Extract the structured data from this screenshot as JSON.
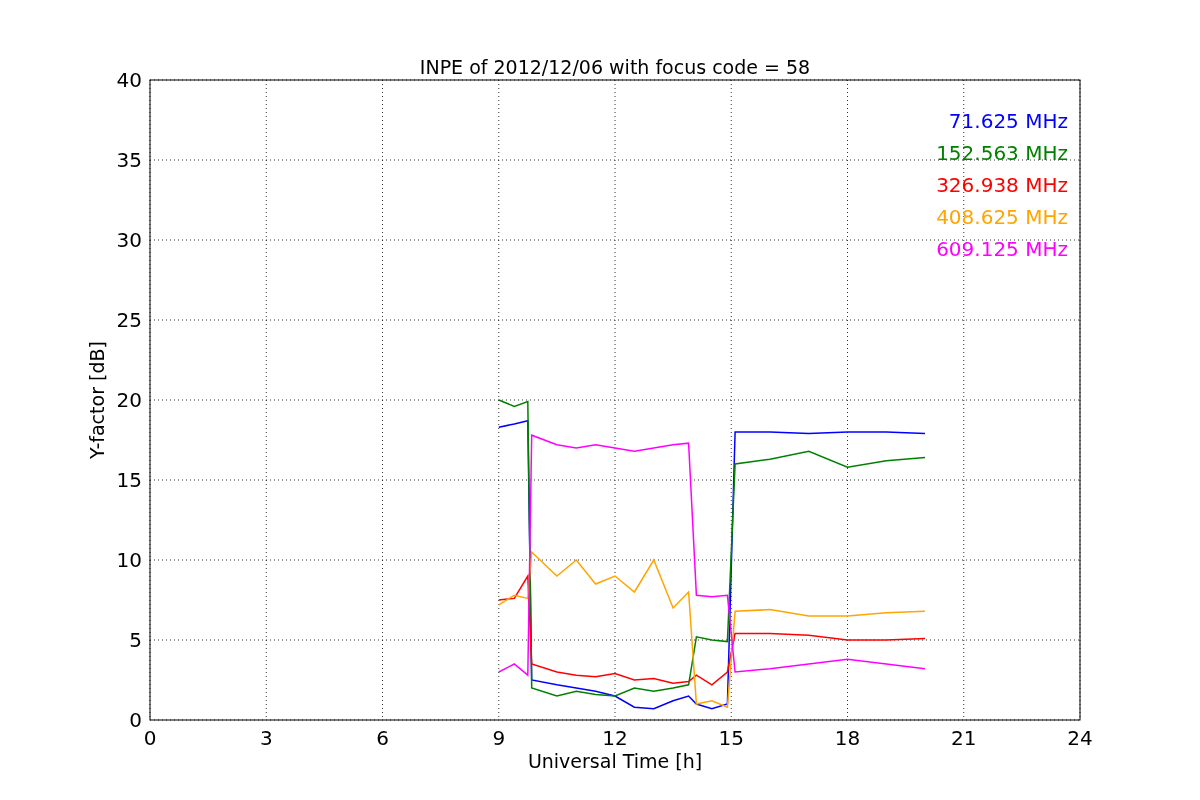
{
  "chart": {
    "chart_data": {
      "type": "line",
      "title": "INPE of 2012/12/06 with focus code = 58",
      "xlabel": "Universal Time [h]",
      "ylabel": "Y-factor [dB]",
      "x": [
        9,
        9.4,
        9.75,
        9.85,
        10.5,
        11,
        11.5,
        12,
        12.5,
        13,
        13.5,
        13.9,
        14.1,
        14.5,
        14.9,
        15.1,
        16,
        17,
        18,
        19,
        20
      ],
      "series": [
        {
          "name": "71.625 MHz",
          "color": "#0000ff",
          "values": [
            18.3,
            18.5,
            18.7,
            2.5,
            2.2,
            2.0,
            1.8,
            1.5,
            0.8,
            0.7,
            1.2,
            1.5,
            1.0,
            0.7,
            1.0,
            18.0,
            18.0,
            17.9,
            18.0,
            18.0,
            17.9
          ]
        },
        {
          "name": "152.563 MHz",
          "color": "#008000",
          "values": [
            20.0,
            19.6,
            19.9,
            2.0,
            1.5,
            1.8,
            1.6,
            1.5,
            2.0,
            1.8,
            2.0,
            2.2,
            5.2,
            5.0,
            4.9,
            16.0,
            16.3,
            16.8,
            15.8,
            16.2,
            16.4
          ]
        },
        {
          "name": "326.938 MHz",
          "color": "#ff0000",
          "values": [
            7.5,
            7.6,
            9.0,
            3.5,
            3.0,
            2.8,
            2.7,
            2.9,
            2.5,
            2.6,
            2.3,
            2.4,
            2.8,
            2.2,
            3.0,
            5.4,
            5.4,
            5.3,
            5.0,
            5.0,
            5.1
          ]
        },
        {
          "name": "408.625 MHz",
          "color": "#ffa500",
          "values": [
            7.2,
            7.8,
            7.6,
            10.5,
            9.0,
            10.0,
            8.5,
            9.0,
            8.0,
            10.0,
            7.0,
            8.0,
            1.0,
            1.2,
            0.8,
            6.8,
            6.9,
            6.5,
            6.5,
            6.7,
            6.8
          ]
        },
        {
          "name": "609.125 MHz",
          "color": "#ff00ff",
          "values": [
            3.0,
            3.5,
            2.8,
            17.8,
            17.2,
            17.0,
            17.2,
            17.0,
            16.8,
            17.0,
            17.2,
            17.3,
            7.8,
            7.7,
            7.8,
            3.0,
            3.2,
            3.5,
            3.8,
            3.5,
            3.2
          ]
        }
      ],
      "xlim": [
        0,
        24
      ],
      "ylim": [
        0,
        40
      ],
      "xticks": [
        0,
        3,
        6,
        9,
        12,
        15,
        18,
        21,
        24
      ],
      "yticks": [
        0,
        5,
        10,
        15,
        20,
        25,
        30,
        35,
        40
      ],
      "grid": true
    }
  }
}
